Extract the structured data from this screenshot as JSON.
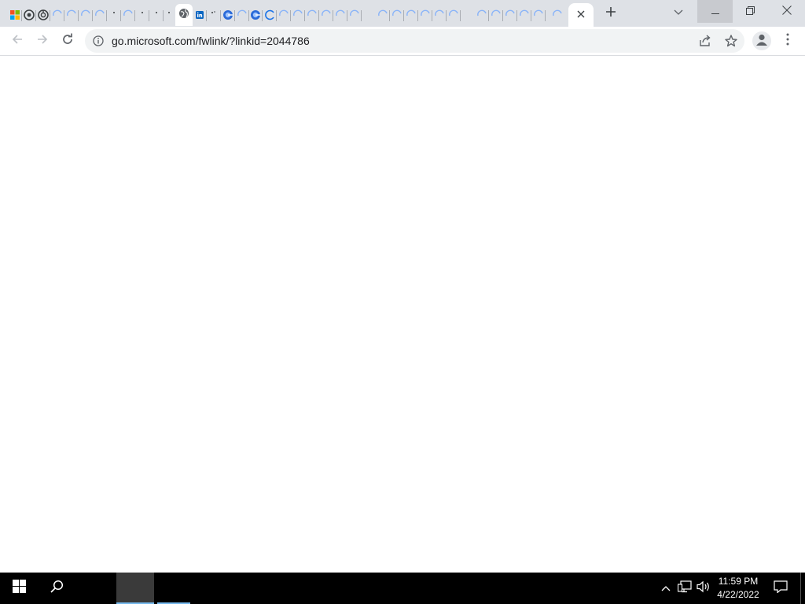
{
  "browser": {
    "tabs": [
      {
        "icon": "windows-logo-icon"
      },
      {
        "icon": "chrome-icon"
      },
      {
        "icon": "chrome-icon"
      },
      {
        "icon": "loading-icon"
      },
      {
        "icon": "loading-icon"
      },
      {
        "icon": "loading-icon"
      },
      {
        "icon": "loading-icon"
      },
      {
        "icon": "loading-icon"
      },
      {
        "icon": "loading-icon"
      },
      {
        "icon": "loading-icon"
      },
      {
        "icon": "loading-icon"
      },
      {
        "icon": "globe-icon"
      },
      {
        "icon": "linkedin-icon"
      },
      {
        "icon": "loading-icon"
      },
      {
        "icon": "edge-icon"
      },
      {
        "icon": "loading-icon"
      },
      {
        "icon": "edge-icon"
      },
      {
        "icon": "loading-icon"
      }
    ],
    "active_tab_close_icon": "close-icon",
    "new_tab_icon": "plus-icon",
    "tab_search_icon": "chevron-down-icon",
    "window_controls": [
      "minimize-icon",
      "restore-icon",
      "close-icon"
    ]
  },
  "toolbar": {
    "back_icon": "arrow-left-icon",
    "forward_icon": "arrow-right-icon",
    "reload_icon": "reload-icon",
    "site_info_icon": "info-icon",
    "url": "go.microsoft.com/fwlink/?linkid=2044786",
    "share_icon": "share-icon",
    "bookmark_icon": "star-icon",
    "profile_icon": "person-icon",
    "menu_icon": "more-vertical-icon"
  },
  "taskbar": {
    "start_icon": "windows-start-icon",
    "search_icon": "search-icon",
    "tray": {
      "chevron_icon": "chevron-up-icon",
      "network_icon": "network-icon",
      "volume_icon": "volume-icon",
      "time": "11:59 PM",
      "date": "4/22/2022",
      "notifications_icon": "notification-icon"
    }
  },
  "colors": {
    "tabstrip_bg": "#dee1e6",
    "omnibox_bg": "#f1f3f4",
    "taskbar_bg": "#000000",
    "taskbar_accent": "#76b9ed"
  }
}
